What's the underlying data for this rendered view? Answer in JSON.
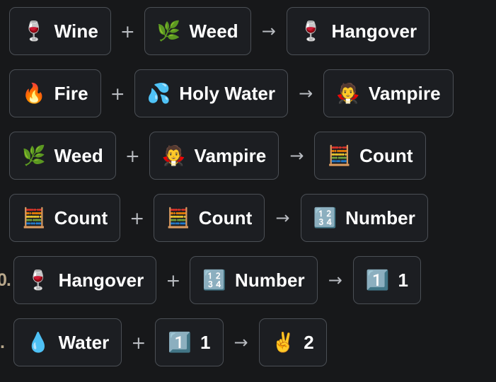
{
  "page": {
    "background_color": "#17181a",
    "chip_background_color": "#1c1e22",
    "chip_border_color": "#4b4f55",
    "text_color": "#ffffff",
    "operator_color": "#b9bcc1"
  },
  "operators": {
    "plus": "+",
    "arrow": "→"
  },
  "recipes": [
    {
      "marker": "",
      "indented": false,
      "input_a": {
        "emoji": "🍷",
        "icon_name": "wine-glass-icon",
        "label": "Wine"
      },
      "input_b": {
        "emoji": "🌿",
        "icon_name": "herb-icon",
        "label": "Weed"
      },
      "output": {
        "emoji": "🍷",
        "icon_name": "wine-glass-icon",
        "label": "Hangover"
      }
    },
    {
      "marker": "",
      "indented": false,
      "input_a": {
        "emoji": "🔥",
        "icon_name": "fire-icon",
        "label": "Fire"
      },
      "input_b": {
        "emoji": "💦",
        "icon_name": "sweat-droplets-icon",
        "label": "Holy Water"
      },
      "output": {
        "emoji": "🧛",
        "icon_name": "vampire-icon",
        "label": "Vampire"
      }
    },
    {
      "marker": "",
      "indented": false,
      "input_a": {
        "emoji": "🌿",
        "icon_name": "herb-icon",
        "label": "Weed"
      },
      "input_b": {
        "emoji": "🧛",
        "icon_name": "vampire-icon",
        "label": "Vampire"
      },
      "output": {
        "emoji": "🧮",
        "icon_name": "abacus-icon",
        "label": "Count"
      }
    },
    {
      "marker": "",
      "indented": false,
      "input_a": {
        "emoji": "🧮",
        "icon_name": "abacus-icon",
        "label": "Count"
      },
      "input_b": {
        "emoji": "🧮",
        "icon_name": "abacus-icon",
        "label": "Count"
      },
      "output": {
        "emoji": "🔢",
        "icon_name": "input-numbers-icon",
        "label": "Number"
      }
    },
    {
      "marker": "0.",
      "indented": true,
      "input_a": {
        "emoji": "🍷",
        "icon_name": "wine-glass-icon",
        "label": "Hangover"
      },
      "input_b": {
        "emoji": "🔢",
        "icon_name": "input-numbers-icon",
        "label": "Number"
      },
      "output": {
        "emoji": "1️⃣",
        "icon_name": "keycap-one-icon",
        "label": "1"
      }
    },
    {
      "marker": ".",
      "indented": true,
      "input_a": {
        "emoji": "💧",
        "icon_name": "droplet-icon",
        "label": "Water"
      },
      "input_b": {
        "emoji": "1️⃣",
        "icon_name": "keycap-one-icon",
        "label": "1"
      },
      "output": {
        "emoji": "✌️",
        "icon_name": "victory-hand-icon",
        "label": "2"
      }
    }
  ]
}
